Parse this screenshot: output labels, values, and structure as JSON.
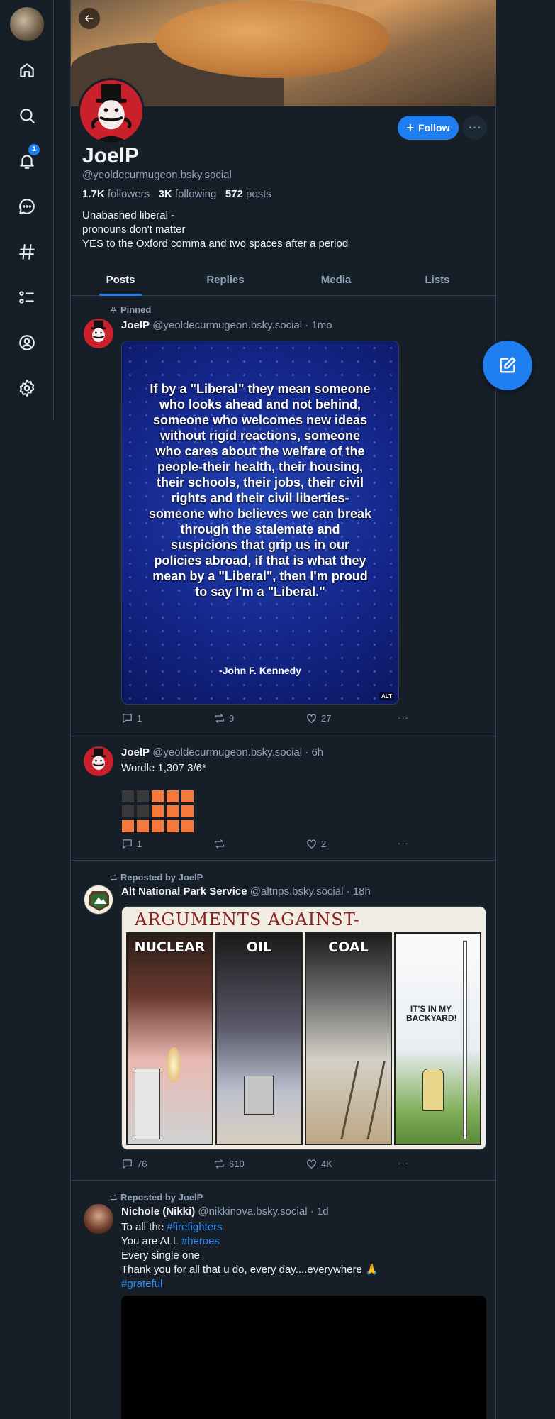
{
  "sidebar": {
    "notification_count": "1",
    "items": [
      "home",
      "search",
      "notifications",
      "chat",
      "feeds",
      "lists",
      "profile",
      "settings"
    ]
  },
  "profile": {
    "display_name": "JoelP",
    "handle": "@yeoldecurmugeon.bsky.social",
    "followers_count": "1.7K",
    "followers_label": "followers",
    "following_count": "3K",
    "following_label": "following",
    "posts_count": "572",
    "posts_label": "posts",
    "bio": [
      "Unabashed liberal -",
      "pronouns don't matter",
      "YES to the Oxford comma and two spaces after a period"
    ],
    "follow_label": "Follow",
    "more_label": "···"
  },
  "tabs": [
    "Posts",
    "Replies",
    "Media",
    "Lists"
  ],
  "active_tab": "Posts",
  "posts": [
    {
      "context": "Pinned",
      "author": "JoelP",
      "handle": "@yeoldecurmugeon.bsky.social",
      "time": "1mo",
      "image_quote": "If by a \"Liberal\" they mean someone who looks ahead and not behind, someone who welcomes new ideas without rigid reactions, someone who cares about the welfare of the people-their health, their housing, their schools, their jobs, their civil rights and their civil liberties-someone who believes we can break through the stalemate and suspicions that grip us in our policies abroad, if that is what they mean by a \"Liberal\", then I'm proud to say I'm a \"Liberal.\"",
      "image_author": "-John F. Kennedy",
      "alt_badge": "ALT",
      "replies": "1",
      "reposts": "9",
      "likes": "27"
    },
    {
      "author": "JoelP",
      "handle": "@yeoldecurmugeon.bsky.social",
      "time": "6h",
      "text": "Wordle 1,307 3/6*",
      "wordle": [
        "g",
        "g",
        "o",
        "o",
        "o",
        "g",
        "g",
        "o",
        "o",
        "o",
        "o",
        "o",
        "o",
        "o",
        "o"
      ],
      "replies": "1",
      "reposts": "",
      "likes": "2"
    },
    {
      "context": "Reposted by JoelP",
      "author": "Alt National Park Service",
      "handle": "@altnps.bsky.social",
      "time": "18h",
      "cartoon_title": "ARGUMENTS AGAINST-",
      "cartoon_panels": [
        "NUCLEAR",
        "OIL",
        "COAL",
        "IT'S IN MY BACKYARD!"
      ],
      "replies": "76",
      "reposts": "610",
      "likes": "4K"
    },
    {
      "context": "Reposted by JoelP",
      "author": "Nichole (Nikki)",
      "handle": "@nikkinova.bsky.social",
      "time": "1d",
      "line1_prefix": "To all the ",
      "line1_tag": "#firefighters",
      "line2_prefix": "You are ALL ",
      "line2_tag": "#heroes",
      "line3": "Every single one",
      "line4": "Thank you for all that u do, every day....everywhere 🙏",
      "line5_tag": "#grateful"
    }
  ],
  "colors": {
    "accent": "#1f7ef0",
    "background": "#161e27",
    "border": "#2e4052",
    "muted": "#8fa3b8",
    "wordle_orange": "#f5793a",
    "wordle_gray": "#3a3a3c"
  }
}
